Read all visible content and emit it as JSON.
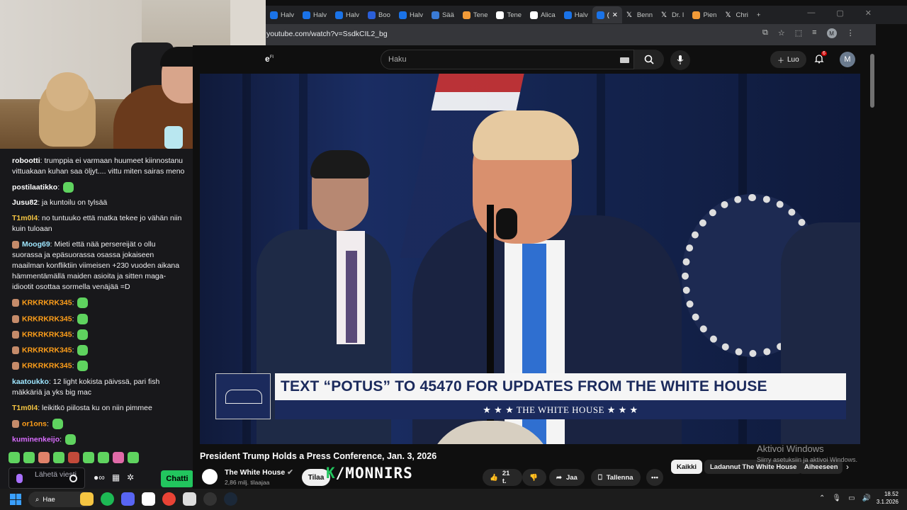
{
  "chat": {
    "messages": [
      {
        "user": "robootti",
        "user_color": "#ffffff",
        "text": "trumppia ei varmaan huumeet kiinnostanu vittuakaan kuhan saa öljyt.... vittu miten sairas meno",
        "emote": false,
        "badge": false
      },
      {
        "user": "postilaatikko",
        "user_color": "#ffffff",
        "text": "",
        "emote": true,
        "badge": false
      },
      {
        "user": "Jusu82",
        "user_color": "#ffffff",
        "text": "ja kuntoilu on tylsää",
        "emote": false,
        "badge": false
      },
      {
        "user": "T1m0l4",
        "user_color": "#f5c542",
        "text": "no tuntuuko että matka tekee jo vähän niin kuin tuloaan",
        "emote": false,
        "badge": false
      },
      {
        "user": "Moog69",
        "user_color": "#9ee6ff",
        "text": "Mieti että nää persereijät o ollu suorassa ja epäsuorassa osassa jokaiseen maailman konfliktiin viimeisen +230 vuoden aikana hämmentämällä maiden asioita ja sitten maga-idiootit osottaa sormella venäjää =D",
        "emote": false,
        "badge": true
      },
      {
        "user": "KRKRKRK345",
        "user_color": "#ff9f1a",
        "text": "",
        "emote": true,
        "badge": true
      },
      {
        "user": "KRKRKRK345",
        "user_color": "#ff9f1a",
        "text": "",
        "emote": true,
        "badge": true
      },
      {
        "user": "KRKRKRK345",
        "user_color": "#ff9f1a",
        "text": "",
        "emote": true,
        "badge": true
      },
      {
        "user": "KRKRKRK345",
        "user_color": "#ff9f1a",
        "text": "",
        "emote": true,
        "badge": true
      },
      {
        "user": "KRKRKRK345",
        "user_color": "#ff9f1a",
        "text": "",
        "emote": true,
        "badge": true
      },
      {
        "user": "kaatoukko",
        "user_color": "#9ee6ff",
        "text": "12 light kokista päivssä, pari fish mäkkäriä ja yks big mac",
        "emote": false,
        "badge": false
      },
      {
        "user": "T1m0l4",
        "user_color": "#f5c542",
        "text": "leikitkö piilosta ku on niin pimmee",
        "emote": false,
        "badge": false
      },
      {
        "user": "or1ons",
        "user_color": "#ff9f1a",
        "text": "",
        "emote": true,
        "badge": true
      },
      {
        "user": "kuminenkeijo",
        "user_color": "#d96cff",
        "text": "",
        "emote": true,
        "badge": false
      }
    ],
    "input_placeholder": "Lähetä viesti",
    "send_label": "Chatti"
  },
  "browser": {
    "tabs": [
      {
        "label": "Halv",
        "icon": "news-icon"
      },
      {
        "label": "Halv",
        "icon": "news-icon"
      },
      {
        "label": "Halv",
        "icon": "news-icon"
      },
      {
        "label": "Boo",
        "icon": "bookmark-icon"
      },
      {
        "label": "Halv",
        "icon": "news-icon"
      },
      {
        "label": "Sää",
        "icon": "weather-icon"
      },
      {
        "label": "Tene",
        "icon": "globe-icon"
      },
      {
        "label": "Tene",
        "icon": "google-icon"
      },
      {
        "label": "Alica",
        "icon": "google-icon"
      },
      {
        "label": "Halv",
        "icon": "news-icon"
      },
      {
        "label": "(",
        "icon": "audio-icon",
        "active": true
      },
      {
        "label": "Benn",
        "icon": "x-icon"
      },
      {
        "label": "Dr. I",
        "icon": "x-icon"
      },
      {
        "label": "Pien",
        "icon": "globe-icon"
      },
      {
        "label": "Chri",
        "icon": "x-icon"
      }
    ],
    "url": "youtube.com/watch?v=SsdkCIL2_bg",
    "profile_initial": "M"
  },
  "youtube": {
    "logo_suffix": "FI",
    "search_placeholder": "Haku",
    "create_label": "Luo",
    "notification_count": "6",
    "avatar_initial": "M",
    "video_title": "President Trump Holds a Press Conference, Jan. 3, 2026",
    "channel_name": "The White House",
    "subscriber_count": "2,86 milj. tilaajaa",
    "subscribe_label": "Tilaa",
    "likes": "21 t.",
    "share_label": "Jaa",
    "save_label": "Tallenna",
    "chips": [
      "Kaikki",
      "Ladannut The White House",
      "Aiheeseen"
    ]
  },
  "video": {
    "banner_headline": "TEXT “POTUS” TO 45470 FOR UPDATES FROM THE WHITE HOUSE",
    "banner_sub": "★ ★ ★   THE WHITE HOUSE   ★ ★ ★"
  },
  "overlay": {
    "logo_k": "K",
    "logo_text": "/MONNIRS"
  },
  "windows_activation": {
    "line1": "Aktivoi Windows",
    "line2": "Siirry asetuksiin ja aktivoi Windows."
  },
  "taskbar": {
    "search_label": "Hae",
    "time": "18.52",
    "date": "3.1.2026"
  }
}
